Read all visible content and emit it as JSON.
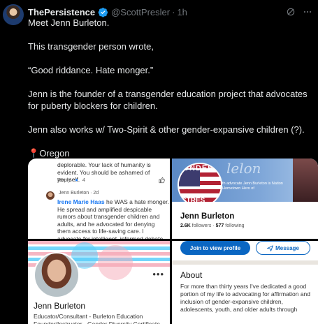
{
  "tweet": {
    "author_name": "ThePersistence",
    "handle": "@ScottPresler",
    "separator": "·",
    "time": "1h",
    "paragraphs": [
      "Meet Jenn Burleton.",
      "This transgender person wrote,",
      "“Good riddance. Hate monger.”",
      "Jenn is the founder of a transgender education project that advocates for puberty blockers for children.",
      "Jenn also works w/ Two-Spirit & other gender-expansive children (?)."
    ],
    "location_pin": "📍",
    "location": "Oregon"
  },
  "colors": {
    "background": "#000000",
    "text": "#e7e9ea",
    "muted": "#71767b",
    "verified": "#1d9bf0",
    "linkedin_blue": "#0a66c2",
    "facebook_blue": "#1877f2"
  },
  "media": {
    "comment_panel": {
      "top_comment": "deplorable. Your lack of humanity is evident. You should be ashamed of yourself.",
      "reply_label": "Reply",
      "reaction_count": "4",
      "reply_author": "Jenn Burleton · 2d",
      "reply_mention": "Irene Marie Haas",
      "reply_text": " he WAS a hate monger. He spread and amplified despicable rumors about transgender children and adults, and he advocated for denying them access to life-saving care. I advocate for intelligent, informed debate. He advocated the spread"
    },
    "profile_top": {
      "banner_script": "lelon",
      "banner_small_text": "th advocate Jenn Burleton is Nation Hometown Hero of",
      "badge_top": "UNDER",
      "badge_bottom": "STRES",
      "name": "Jenn Burleton",
      "followers_count": "2.6K",
      "followers_label": "followers",
      "stats_sep": "·",
      "following_count": "577",
      "following_label": "following"
    },
    "profile_bottom_left": {
      "more": "•••",
      "name": "Jenn Burleton",
      "title": "Educator/Consultant - Burleton Education Founder/Instructor - Gender Diversity Certificate"
    },
    "profile_bottom_right": {
      "view_profile_button": "Join to view profile",
      "message_button": "Message",
      "about_heading": "About",
      "about_text": "For more than thirty years I've dedicated a good portion of my life to advocating for affirmation and inclusion of gender-expansive children, adolescents, youth, and older adults through"
    }
  }
}
